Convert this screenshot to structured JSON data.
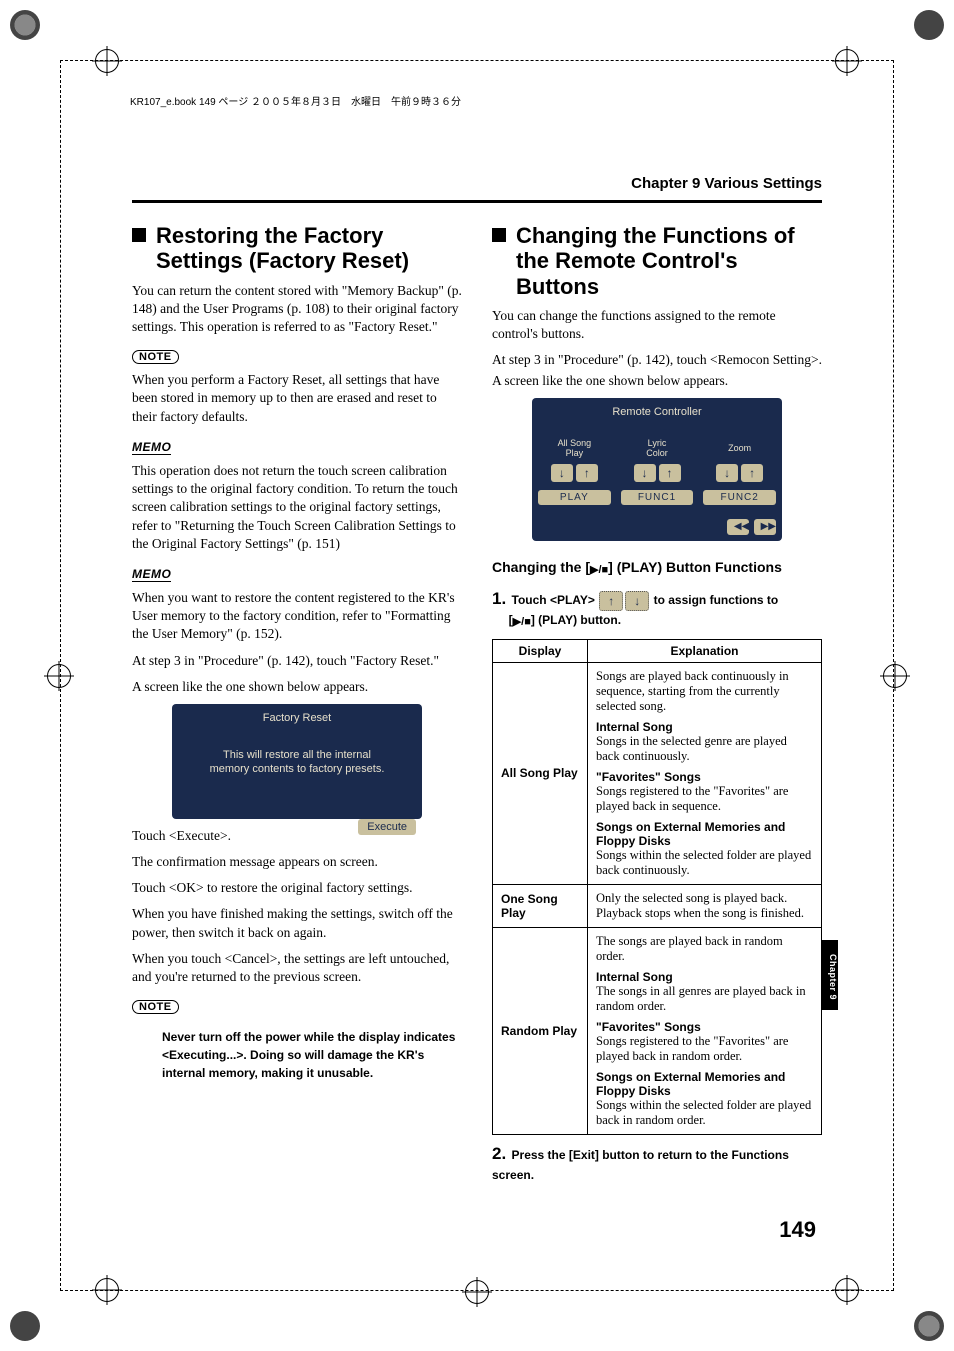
{
  "print": {
    "header": "KR107_e.book  149 ページ  ２００５年８月３日　水曜日　午前９時３６分"
  },
  "chapter": {
    "title": "Chapter 9 Various Settings",
    "sidetab": "Chapter 9",
    "page_number": "149"
  },
  "left": {
    "h1": "Restoring the Factory Settings (Factory Reset)",
    "p1": "You can return the content stored with \"Memory Backup\" (p. 148) and the User Programs (p. 108) to their original factory settings. This operation is referred to as \"Factory Reset.\"",
    "note1_label": "NOTE",
    "note1": "When you perform a Factory Reset, all settings that have been stored in memory up to then are erased and reset to their factory defaults.",
    "memo1_label": "MEMO",
    "memo1": "This operation does not return the touch screen calibration settings to the original factory condition. To return the touch screen calibration settings to the original factory settings, refer to \"Returning the Touch Screen Calibration Settings to the Original Factory Settings\" (p. 151)",
    "memo2_label": "MEMO",
    "memo2": "When you want to restore the content registered to the KR's User memory to the factory condition, refer to \"Formatting the User Memory\" (p. 152).",
    "p2": "At step 3 in \"Procedure\" (p. 142), touch \"Factory Reset.\"",
    "p3": "A screen like the one shown below appears.",
    "screen": {
      "title": "Factory Reset",
      "msg": "This will restore all the internal\nmemory contents to factory presets.",
      "execute": "Execute"
    },
    "p4": "Touch <Execute>.",
    "p5": "The confirmation message appears on screen.",
    "p6": "Touch <OK> to restore the original factory settings.",
    "p7": "When you have finished making the settings, switch off the power, then switch it back on again.",
    "p8": "When you touch <Cancel>, the settings are left untouched, and you're returned to the previous screen.",
    "note2_label": "NOTE",
    "note2": "Never turn off the power while the display indicates <Executing...>. Doing so will damage the KR's internal memory, making it unusable."
  },
  "right": {
    "h1": "Changing the Functions of the Remote Control's Buttons",
    "p1": "You can change the functions assigned to the remote control's buttons.",
    "p2": "At step 3 in \"Procedure\" (p. 142), touch <Remocon Setting>.",
    "p3": "A screen like the one shown below appears.",
    "screen": {
      "title": "Remote Controller",
      "cell1": "All Song\nPlay",
      "cell2": "Lyric\nColor",
      "cell3": "Zoom",
      "func1": "PLAY",
      "func2": "FUNC1",
      "func3": "FUNC2"
    },
    "sub_a": "Changing the [",
    "sub_b": "] (PLAY) Button Functions",
    "step1_a": "Touch <PLAY>",
    "step1_b": "to assign functions to",
    "step1_c_a": "[",
    "step1_c_b": "] (PLAY) button.",
    "table": {
      "h1": "Display",
      "h2": "Explanation",
      "r1_disp": "All Song Play",
      "r1_a": "Songs are played back continuously in sequence, starting from the currently selected song.",
      "r1_b_head": "Internal Song",
      "r1_b": "Songs in the selected genre are played back continuously.",
      "r1_c_head": "\"Favorites\" Songs",
      "r1_c": "Songs registered to the \"Favorites\" are played back in sequence.",
      "r1_d_head": "Songs on External Memories and Floppy Disks",
      "r1_d": "Songs within the selected folder are played back continuously.",
      "r2_disp": "One Song Play",
      "r2": "Only the selected song is played back. Playback stops when the song is finished.",
      "r3_disp": "Random Play",
      "r3_a": "The songs are played back in random order.",
      "r3_b_head": "Internal Song",
      "r3_b": "The songs in all genres are played back in random order.",
      "r3_c_head": "\"Favorites\" Songs",
      "r3_c": "Songs registered to the \"Favorites\" are played back in random order.",
      "r3_d_head": "Songs on External Memories and Floppy Disks",
      "r3_d": "Songs within the selected folder are played back in random order."
    },
    "step2": "Press the [Exit] button to return to the Functions screen."
  }
}
